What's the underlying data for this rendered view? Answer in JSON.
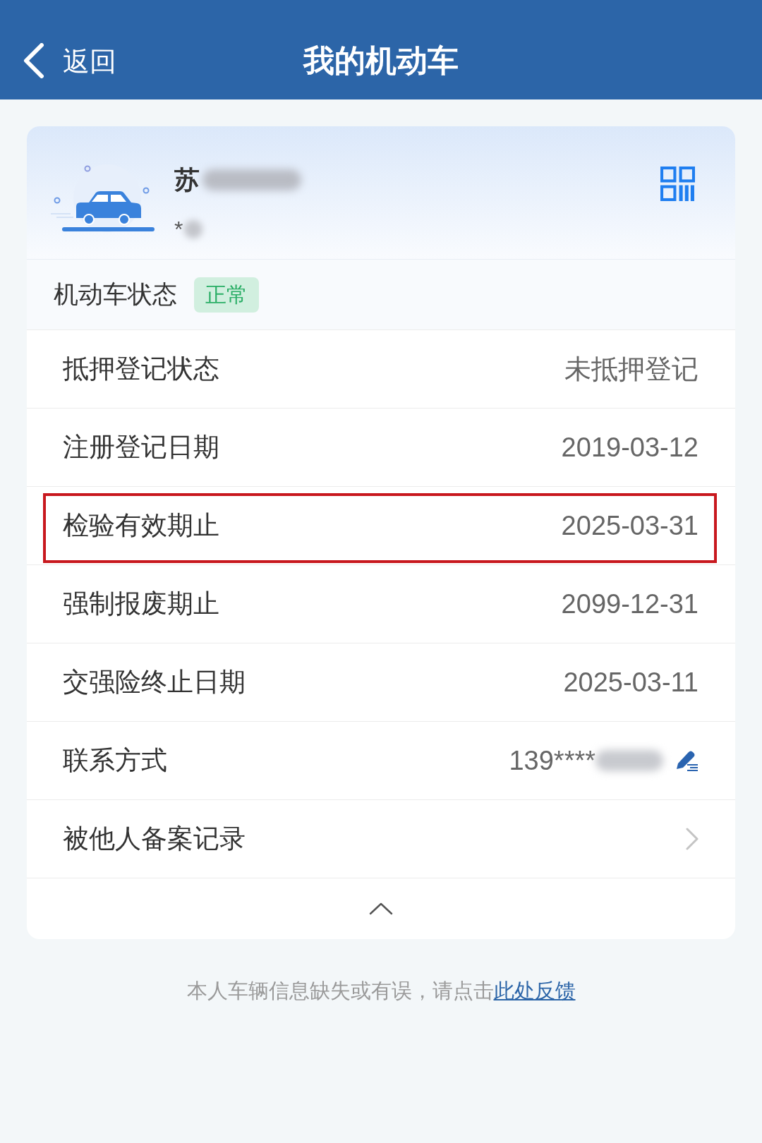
{
  "header": {
    "back_label": "返回",
    "title": "我的机动车"
  },
  "vehicle": {
    "plate_prefix": "苏",
    "owner_prefix": "*",
    "blurred": true
  },
  "status": {
    "label": "机动车状态",
    "badge": "正常"
  },
  "rows": [
    {
      "kind": "value",
      "label": "抵押登记状态",
      "value": "未抵押登记",
      "highlighted": false
    },
    {
      "kind": "value",
      "label": "注册登记日期",
      "value": "2019-03-12",
      "highlighted": false
    },
    {
      "kind": "value",
      "label": "检验有效期止",
      "value": "2025-03-31",
      "highlighted": true
    },
    {
      "kind": "value",
      "label": "强制报废期止",
      "value": "2099-12-31",
      "highlighted": false
    },
    {
      "kind": "value",
      "label": "交强险终止日期",
      "value": "2025-03-11",
      "highlighted": false
    },
    {
      "kind": "contact",
      "label": "联系方式",
      "value": "139****",
      "blurred": true,
      "highlighted": false
    },
    {
      "kind": "link",
      "label": "被他人备案记录",
      "highlighted": false
    }
  ],
  "details": {
    "expanded": true
  },
  "footer": {
    "text": "本人车辆信息缺失或有误，请点击",
    "link": "此处反馈"
  }
}
